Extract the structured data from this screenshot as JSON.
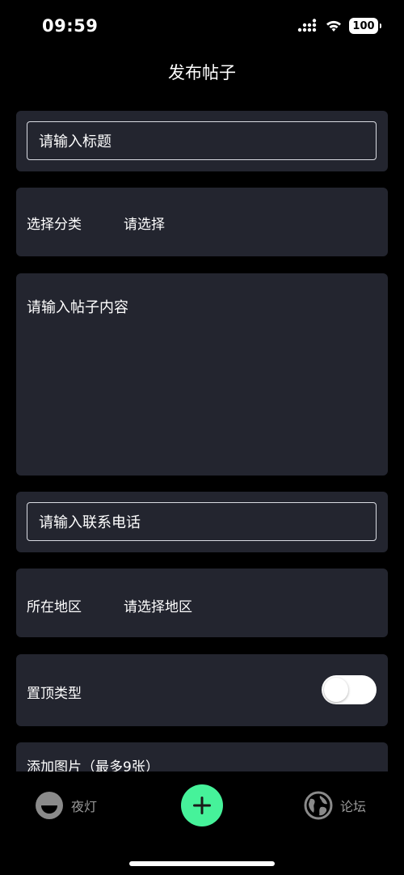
{
  "status_bar": {
    "time": "09:59",
    "battery": "100"
  },
  "header": {
    "title": "发布帖子"
  },
  "form": {
    "title_placeholder": "请输入标题",
    "category_label": "选择分类",
    "category_value": "请选择",
    "content_placeholder": "请输入帖子内容",
    "phone_placeholder": "请输入联系电话",
    "region_label": "所在地区",
    "region_value": "请选择地区",
    "pin_label": "置顶类型",
    "pin_enabled": false,
    "images_label": "添加图片（最多9张）"
  },
  "tab_bar": {
    "left_label": "夜灯",
    "right_label": "论坛",
    "center_icon": "plus-icon",
    "accent_color": "#46f29a"
  }
}
